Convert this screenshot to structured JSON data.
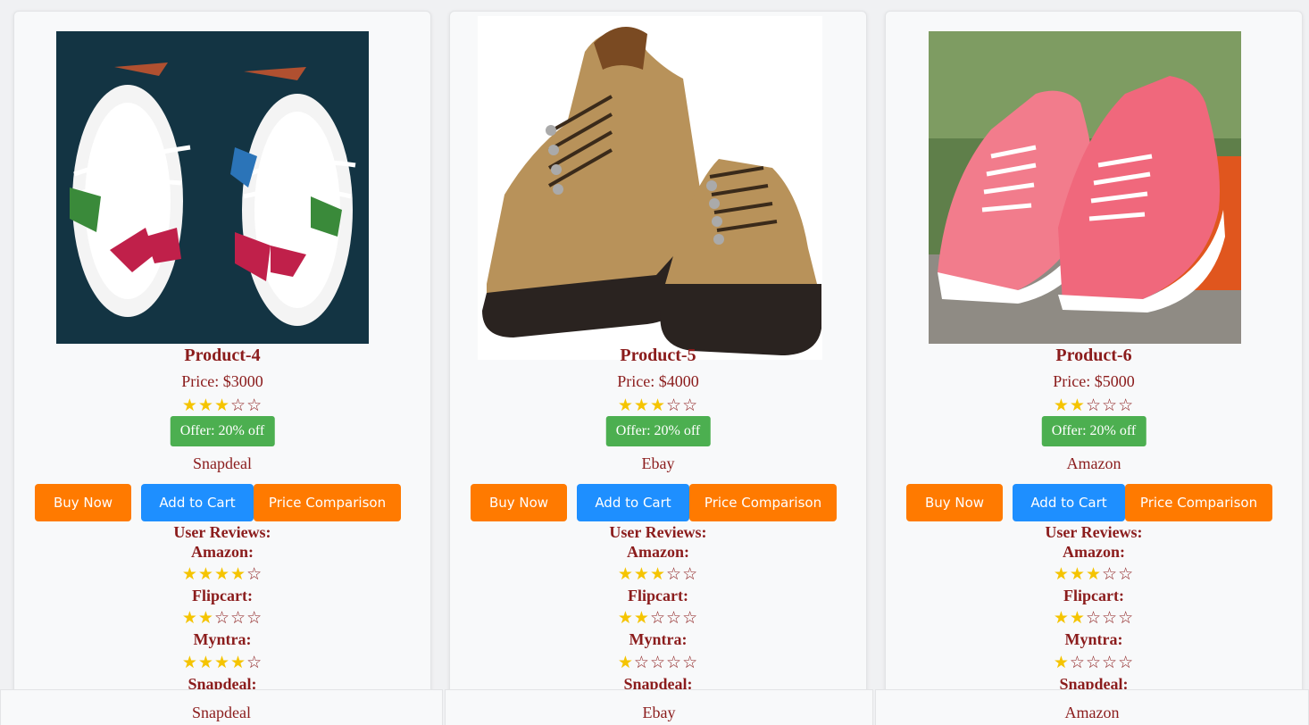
{
  "products": [
    {
      "title": "Product-4",
      "price": "Price: $3000",
      "rating": 3,
      "offer": "Offer: 20% off",
      "store": "Snapdeal",
      "buy_label": "Buy Now",
      "cart_label": "Add to Cart",
      "compare_label": "Price Comparison",
      "reviews_heading": "User Reviews:",
      "reviews": [
        {
          "source": "Amazon:",
          "rating": 4
        },
        {
          "source": "Flipcart:",
          "rating": 2
        },
        {
          "source": "Myntra:",
          "rating": 4
        },
        {
          "source": "Snapdeal:",
          "rating": 0
        }
      ],
      "footer_store": "Snapdeal"
    },
    {
      "title": "Product-5",
      "price": "Price: $4000",
      "rating": 3,
      "offer": "Offer: 20% off",
      "store": "Ebay",
      "buy_label": "Buy Now",
      "cart_label": "Add to Cart",
      "compare_label": "Price Comparison",
      "reviews_heading": "User Reviews:",
      "reviews": [
        {
          "source": "Amazon:",
          "rating": 3
        },
        {
          "source": "Flipcart:",
          "rating": 2
        },
        {
          "source": "Myntra:",
          "rating": 1
        },
        {
          "source": "Snapdeal:",
          "rating": 0
        }
      ],
      "footer_store": "Ebay"
    },
    {
      "title": "Product-6",
      "price": "Price: $5000",
      "rating": 2,
      "offer": "Offer: 20% off",
      "store": "Amazon",
      "buy_label": "Buy Now",
      "cart_label": "Add to Cart",
      "compare_label": "Price Comparison",
      "reviews_heading": "User Reviews:",
      "reviews": [
        {
          "source": "Amazon:",
          "rating": 3
        },
        {
          "source": "Flipcart:",
          "rating": 2
        },
        {
          "source": "Myntra:",
          "rating": 1
        },
        {
          "source": "Snapdeal:",
          "rating": 0
        }
      ],
      "footer_store": "Amazon"
    }
  ],
  "colors": {
    "buy": "#ff7a00",
    "cart": "#1e8fff",
    "offer": "#4caf50",
    "text": "#8b1c1c",
    "star": "#f5c400"
  }
}
